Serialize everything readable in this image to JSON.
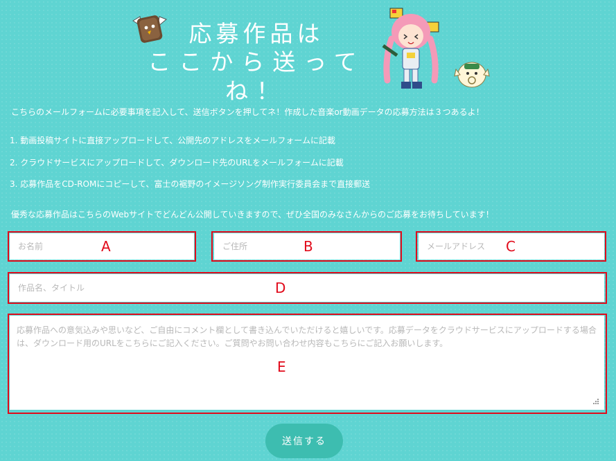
{
  "header": {
    "title_line1": "応募作品は",
    "title_line2": "ここから送ってね！"
  },
  "intro": {
    "lead": "こちらのメールフォームに必要事項を記入して、送信ボタンを押してネ！作成した音楽or動画データの応募方法は３つあるよ！",
    "steps": [
      "1. 動画投稿サイトに直接アップロードして、公開先のアドレスをメールフォームに記載",
      "2. クラウドサービスにアップロードして、ダウンロード先のURLをメールフォームに記載",
      "3. 応募作品をCD-ROMにコピーして、富士の裾野のイメージソング制作実行委員会まで直接郵送"
    ],
    "closing": "優秀な応募作品はこちらのWebサイトでどんどん公開していきますので、ぜひ全国のみなさんからのご応募をお待ちしています！"
  },
  "form": {
    "name_placeholder": "お名前",
    "address_placeholder": "ご住所",
    "email_placeholder": "メールアドレス",
    "title_placeholder": "作品名、タイトル",
    "message_placeholder": "応募作品への意気込みや思いなど、ご自由にコメント欄として書き込んでいただけると嬉しいです。応募データをクラウドサービスにアップロードする場合は、ダウンロード用のURLをこちらにご記入ください。ご質問やお問い合わせ内容もこちらにご記入お願いします。",
    "submit_label": "送信する"
  },
  "annotations": {
    "a": "A",
    "b": "B",
    "c": "C",
    "d": "D",
    "e": "E"
  },
  "colors": {
    "background": "#5fd4d2",
    "callout": "#e10a1a",
    "submit": "#3dbdb0"
  }
}
